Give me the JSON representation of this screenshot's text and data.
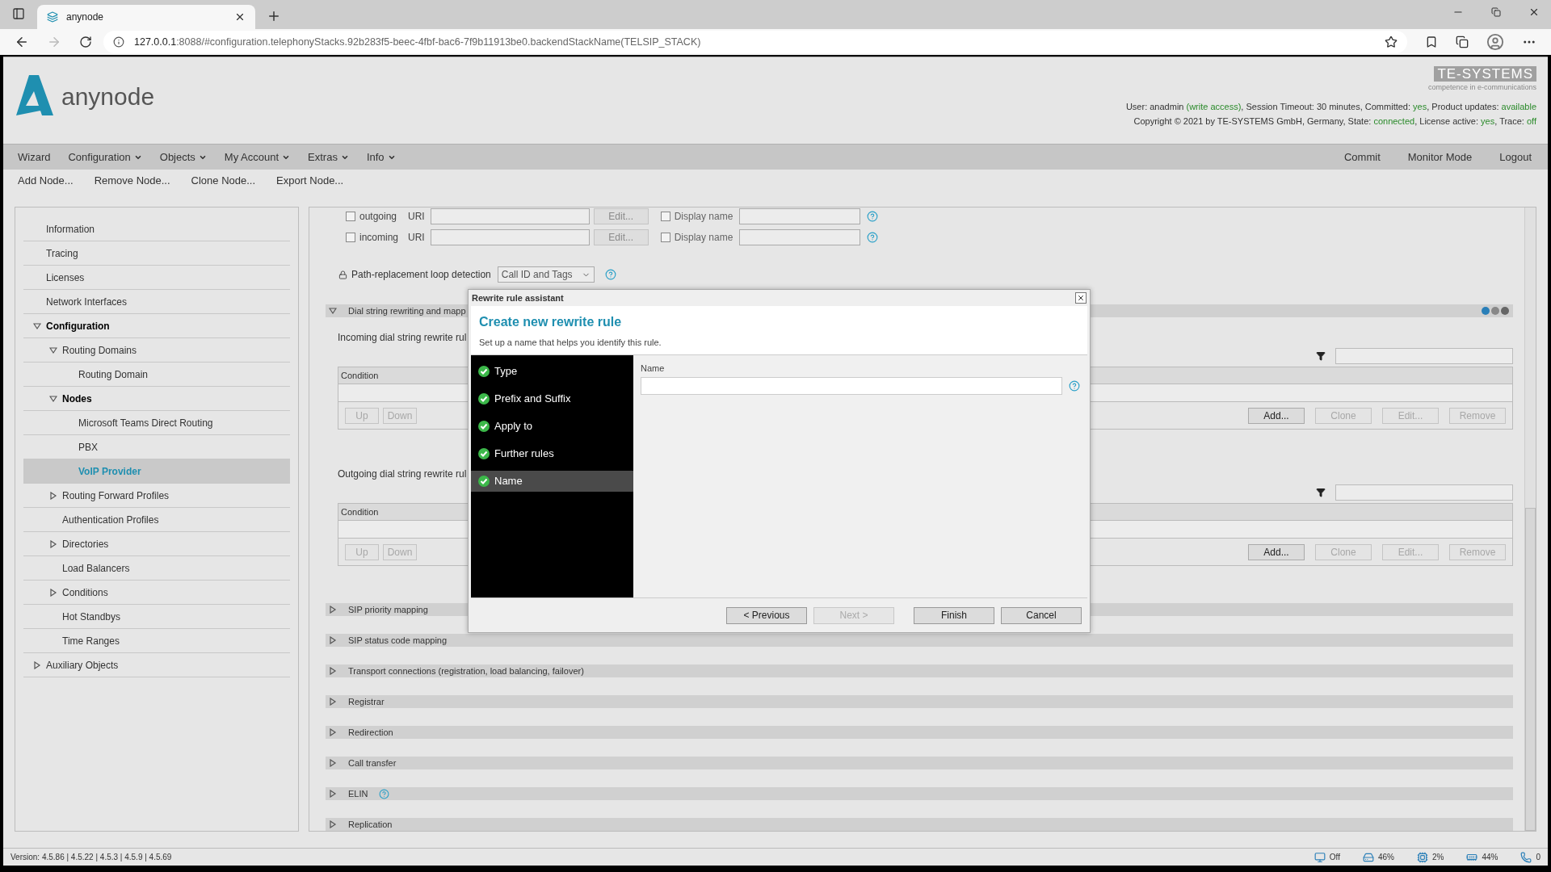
{
  "browser": {
    "tab_title": "anynode",
    "url_host": "127.0.0.1",
    "url_rest": ":8088/#configuration.telephonyStacks.92b283f5-beec-4fbf-bac6-7f9b11913be0.backendStackName(TELSIP_STACK)"
  },
  "app": {
    "logo_text": "anynode",
    "vendor": "TE-SYSTEMS",
    "vendor_tagline": "competence in e-communications",
    "info_lines": [
      [
        {
          "text": "User: anadmin ",
          "value": false
        },
        {
          "text": "(write access)",
          "value": true
        },
        {
          "text": ", Session Timeout: 30 minutes, Committed: ",
          "value": false
        },
        {
          "text": "yes",
          "value": true
        },
        {
          "text": ", Product updates: ",
          "value": false
        },
        {
          "text": "available",
          "value": true
        }
      ],
      [
        {
          "text": "Copyright © 2021 by TE-SYSTEMS GmbH, Germany, State: ",
          "value": false
        },
        {
          "text": "connected",
          "value": true
        },
        {
          "text": ", License active: ",
          "value": false
        },
        {
          "text": "yes",
          "value": true
        },
        {
          "text": ", Trace: ",
          "value": false
        },
        {
          "text": "off",
          "value": true
        }
      ]
    ]
  },
  "menu": [
    {
      "label": "Wizard",
      "dropdown": false
    },
    {
      "label": "Configuration",
      "dropdown": true
    },
    {
      "label": "Objects",
      "dropdown": true
    },
    {
      "label": "My Account",
      "dropdown": true
    },
    {
      "label": "Extras",
      "dropdown": true
    },
    {
      "label": "Info",
      "dropdown": true
    }
  ],
  "menu_right": [
    "Commit",
    "Monitor Mode",
    "Logout"
  ],
  "toolbar": [
    "Add Node...",
    "Remove Node...",
    "Clone Node...",
    "Export Node..."
  ],
  "sidebar": [
    {
      "label": "Information",
      "selected": false
    },
    {
      "label": "Tracing",
      "selected": false
    },
    {
      "label": "Licenses",
      "selected": false
    },
    {
      "label": "Network Interfaces",
      "selected": false
    },
    {
      "label": "Configuration",
      "selected": false,
      "expanded": true,
      "children": [
        {
          "label": "Routing Domains",
          "selected": false,
          "expanded": true,
          "children": [
            {
              "label": "Routing Domain",
              "selected": false
            }
          ]
        },
        {
          "label": "Nodes",
          "selected": false,
          "expanded": true,
          "children": [
            {
              "label": "Microsoft Teams Direct Routing",
              "selected": false
            },
            {
              "label": "PBX",
              "selected": false
            },
            {
              "label": "VoIP Provider",
              "selected": true
            }
          ]
        },
        {
          "label": "Routing Forward Profiles",
          "selected": false,
          "expanded": false
        },
        {
          "label": "Authentication Profiles",
          "selected": false
        },
        {
          "label": "Directories",
          "selected": false,
          "expanded": false
        },
        {
          "label": "Load Balancers",
          "selected": false
        },
        {
          "label": "Conditions",
          "selected": false,
          "expanded": false
        },
        {
          "label": "Hot Standbys",
          "selected": false
        },
        {
          "label": "Time Ranges",
          "selected": false
        }
      ]
    },
    {
      "label": "Auxiliary Objects",
      "selected": false,
      "expanded": false
    }
  ],
  "main": {
    "uri_rows": [
      {
        "label": "outgoing",
        "checked": false,
        "uri_label": "URI",
        "edit": "Edit...",
        "display_checked": false,
        "display_label": "Display name"
      },
      {
        "label": "incoming",
        "checked": false,
        "uri_label": "URI",
        "edit": "Edit...",
        "display_checked": false,
        "display_label": "Display name"
      }
    ],
    "loop_detection": {
      "label": "Path-replacement loop detection",
      "value": "Call ID and Tags"
    },
    "dial_section": {
      "title": "Dial string rewriting and mapp",
      "expanded": true,
      "tables": [
        {
          "title": "Incoming dial string rewrite rul",
          "column": "Condition",
          "left_buttons": [
            {
              "label": "Up",
              "disabled": true
            },
            {
              "label": "Down",
              "disabled": true
            }
          ],
          "right_buttons": [
            {
              "label": "Add...",
              "disabled": false
            },
            {
              "label": "Clone",
              "disabled": true
            },
            {
              "label": "Edit...",
              "disabled": true
            },
            {
              "label": "Remove",
              "disabled": true
            }
          ]
        },
        {
          "title": "Outgoing dial string rewrite rul",
          "column": "Condition",
          "left_buttons": [
            {
              "label": "Up",
              "disabled": true
            },
            {
              "label": "Down",
              "disabled": true
            }
          ],
          "right_buttons": [
            {
              "label": "Add...",
              "disabled": false
            },
            {
              "label": "Clone",
              "disabled": true
            },
            {
              "label": "Edit...",
              "disabled": true
            },
            {
              "label": "Remove",
              "disabled": true
            }
          ]
        }
      ]
    },
    "sections": [
      {
        "title": "SIP priority mapping",
        "expanded": false,
        "help": false
      },
      {
        "title": "SIP status code mapping",
        "expanded": false,
        "help": false
      },
      {
        "title": "Transport connections (registration, load balancing, failover)",
        "expanded": false,
        "help": false
      },
      {
        "title": "Registrar",
        "expanded": false,
        "help": false
      },
      {
        "title": "Redirection",
        "expanded": false,
        "help": false
      },
      {
        "title": "Call transfer",
        "expanded": false,
        "help": false
      },
      {
        "title": "ELIN",
        "expanded": false,
        "help": true
      },
      {
        "title": "Replication",
        "expanded": false,
        "help": false
      }
    ]
  },
  "dialog": {
    "title": "Rewrite rule assistant",
    "heading": "Create new rewrite rule",
    "subtitle": "Set up a name that helps you identify this rule.",
    "steps": [
      {
        "label": "Type",
        "done": true,
        "selected": false
      },
      {
        "label": "Prefix and Suffix",
        "done": true,
        "selected": false
      },
      {
        "label": "Apply to",
        "done": true,
        "selected": false
      },
      {
        "label": "Further rules",
        "done": true,
        "selected": false
      },
      {
        "label": "Name",
        "done": true,
        "selected": true
      }
    ],
    "field_label": "Name",
    "buttons": [
      {
        "label": "< Previous",
        "disabled": false
      },
      {
        "label": "Next >",
        "disabled": true
      },
      {
        "label": "Finish",
        "disabled": false
      },
      {
        "label": "Cancel",
        "disabled": false
      }
    ]
  },
  "status_bar": {
    "version": "Version: 4.5.86 | 4.5.22 | 4.5.3 | 4.5.9 | 4.5.69",
    "indicators": [
      {
        "kind": "network",
        "value": "Off"
      },
      {
        "kind": "disk",
        "value": "46%"
      },
      {
        "kind": "cpu",
        "value": "2%"
      },
      {
        "kind": "memory",
        "value": "44%"
      },
      {
        "kind": "calls",
        "value": "0"
      }
    ]
  }
}
